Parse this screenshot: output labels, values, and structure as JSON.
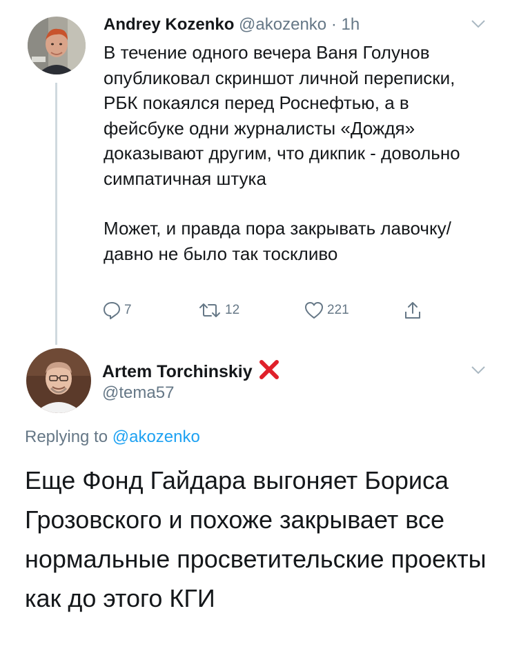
{
  "tweet1": {
    "name": "Andrey Kozenko",
    "handle": "@akozenko",
    "separator": " · ",
    "time": "1h",
    "paragraph1": "В течение одного вечера Ваня Голунов опубликовал скриншот личной переписки, РБК покаялся перед Роснефтью, а в фейсбуке одни журналисты «Дождя» доказывают другим, что дикпик - довольно симпатичная штука",
    "paragraph2": "Может, и правда пора закрывать лавочку/давно не было так тоскливо",
    "actions": {
      "reply_count": "7",
      "retweet_count": "12",
      "like_count": "221"
    }
  },
  "tweet2": {
    "name": "Artem Torchinskiy",
    "name_emoji": "❌",
    "handle": "@tema57",
    "replying_prefix": "Replying to ",
    "replying_handle": "@akozenko",
    "text": "Еще Фонд Гайдара выгоняет Бориса Грозовского и похоже закрывает все нормальные просветительские проекты как до этого КГИ"
  },
  "colors": {
    "secondary_text": "#657786",
    "link": "#1da1f2",
    "thread_line": "#cfd9de",
    "x_mark": "#e0202a"
  },
  "icons": [
    "chevron-down-icon",
    "reply-icon",
    "retweet-icon",
    "like-icon",
    "share-icon",
    "cross-mark-icon"
  ]
}
